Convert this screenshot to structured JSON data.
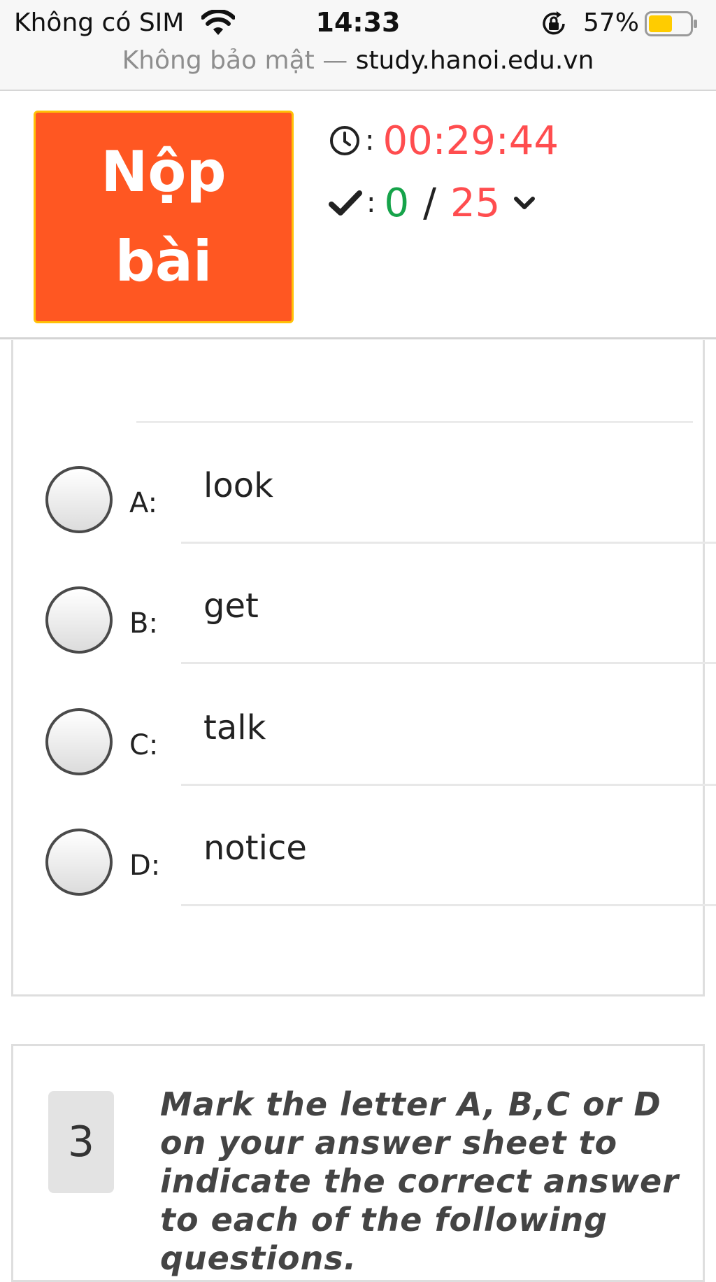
{
  "status_bar": {
    "carrier": "Không có SIM",
    "time": "14:33",
    "battery_percent": "57%",
    "battery_level": 0.57,
    "battery_color": "#ffcc00",
    "icons": [
      "wifi-icon",
      "rotation-lock-icon",
      "battery-icon"
    ]
  },
  "address_bar": {
    "security_label": "Không bảo mật —",
    "domain": "study.hanoi.edu.vn"
  },
  "header": {
    "submit_label": "Nộp bài",
    "submit_color": "#ff5722",
    "timer_icon": "clock-icon",
    "timer": "00:29:44",
    "progress_icon": "check-icon",
    "answered": "0",
    "total": "25",
    "expand_icon": "chevron-down-icon"
  },
  "question_2": {
    "options": [
      {
        "letter": "A:",
        "text": "look"
      },
      {
        "letter": "B:",
        "text": "get"
      },
      {
        "letter": "C:",
        "text": "talk"
      },
      {
        "letter": "D:",
        "text": "notice"
      }
    ]
  },
  "question_3": {
    "number": "3",
    "prompt": "Mark the letter A, B,C or D on your answer sheet to indicate the correct answer to each of the following questions."
  }
}
